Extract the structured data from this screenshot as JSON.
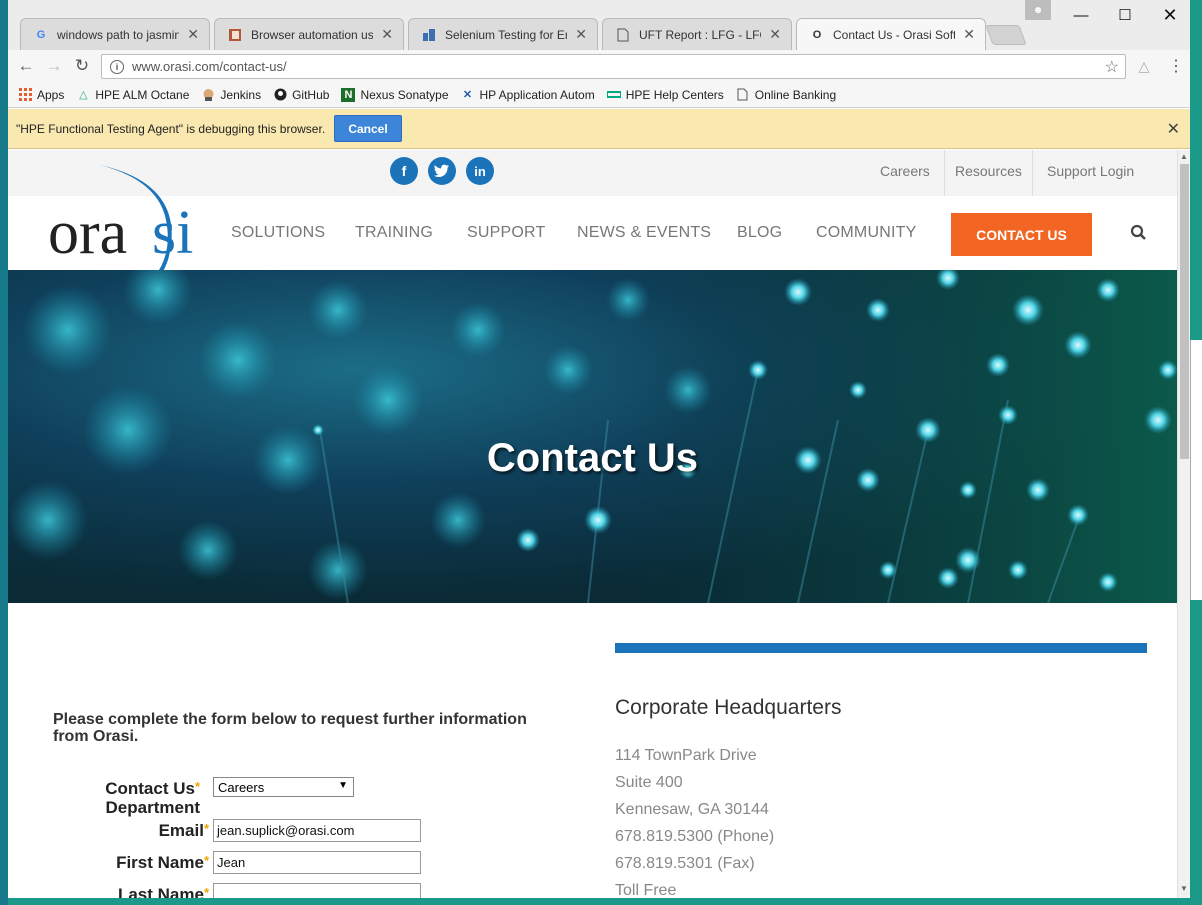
{
  "browser": {
    "tabs": [
      {
        "title": "windows path to jasmine",
        "favicon": "google-icon"
      },
      {
        "title": "Browser automation usin",
        "favicon": "book-icon"
      },
      {
        "title": "Selenium Testing for Ente",
        "favicon": "selenium-icon"
      },
      {
        "title": "UFT Report : LFG - LFG",
        "favicon": "page-icon"
      },
      {
        "title": "Contact Us - Orasi Softw",
        "favicon": "orasi-icon"
      }
    ],
    "url": "www.orasi.com/contact-us/",
    "bookmarks": [
      {
        "label": "Apps",
        "icon": "apps-grid-icon"
      },
      {
        "label": "HPE ALM Octane",
        "icon": "octane-icon"
      },
      {
        "label": "Jenkins",
        "icon": "jenkins-icon"
      },
      {
        "label": "GitHub",
        "icon": "github-icon"
      },
      {
        "label": "Nexus Sonatype",
        "icon": "nexus-icon"
      },
      {
        "label": "HP Application Autom",
        "icon": "hp-icon"
      },
      {
        "label": "HPE Help Centers",
        "icon": "hpe-icon"
      },
      {
        "label": "Online Banking",
        "icon": "page-icon"
      }
    ],
    "infobar": {
      "message": "\"HPE Functional Testing Agent\" is debugging this browser.",
      "cancel": "Cancel"
    }
  },
  "site": {
    "logo": "orasi",
    "social": [
      "f",
      "t",
      "in"
    ],
    "toplinks": [
      "Careers",
      "Resources",
      "Support Login"
    ],
    "nav": [
      "SOLUTIONS",
      "TRAINING",
      "SUPPORT",
      "NEWS & EVENTS",
      "BLOG",
      "COMMUNITY"
    ],
    "contact_button": "CONTACT US",
    "hero_title": "Contact Us",
    "form": {
      "intro": "Please complete the form below to request further information from Orasi.",
      "dept_label_1": "Contact Us",
      "dept_label_2": "Department",
      "dept_value": "Careers",
      "email_label": "Email",
      "email_value": "jean.suplick@orasi.com",
      "first_label": "First Name",
      "first_value": "Jean",
      "last_label": "Last Name",
      "last_value": "",
      "required_mark": "*"
    },
    "hq": {
      "title": "Corporate Headquarters",
      "lines": [
        "114 TownPark Drive",
        "Suite 400",
        "Kennesaw, GA 30144",
        "678.819.5300 (Phone)",
        "678.819.5301 (Fax)",
        "Toll Free"
      ]
    }
  },
  "colors": {
    "brand_blue": "#1b74ba",
    "contact_orange": "#f26522",
    "infobar": "#f9e9b0"
  }
}
